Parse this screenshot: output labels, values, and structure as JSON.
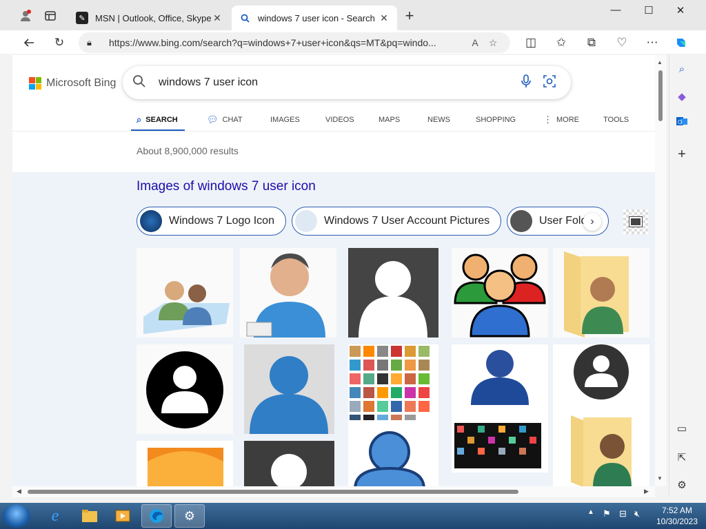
{
  "browser": {
    "tabs": [
      {
        "title": "MSN | Outlook, Office, Skype, Bing",
        "favicon": "msn-icon"
      },
      {
        "title": "windows 7 user icon - Search",
        "favicon": "search-icon"
      }
    ],
    "address": "https://www.bing.com/search?q=windows+7+user+icon&qs=MT&pq=windo..."
  },
  "bing": {
    "logo_text": "Microsoft Bing",
    "query": "windows 7 user icon",
    "nav": [
      "SEARCH",
      "CHAT",
      "IMAGES",
      "VIDEOS",
      "MAPS",
      "NEWS",
      "SHOPPING",
      "MORE",
      "TOOLS"
    ],
    "active_nav": "SEARCH",
    "results_count": "About 8,900,000 results",
    "images_title": "Images of windows 7 user icon",
    "chips": [
      "Windows 7 Logo Icon",
      "Windows 7 User Account Pictures",
      "User Folder"
    ]
  },
  "taskbar": {
    "time": "7:52 AM",
    "date": "10/30/2023"
  },
  "colors": {
    "accent": "#1a5bbf",
    "link": "#1a0dab",
    "image_section_bg": "#eef3f9"
  }
}
